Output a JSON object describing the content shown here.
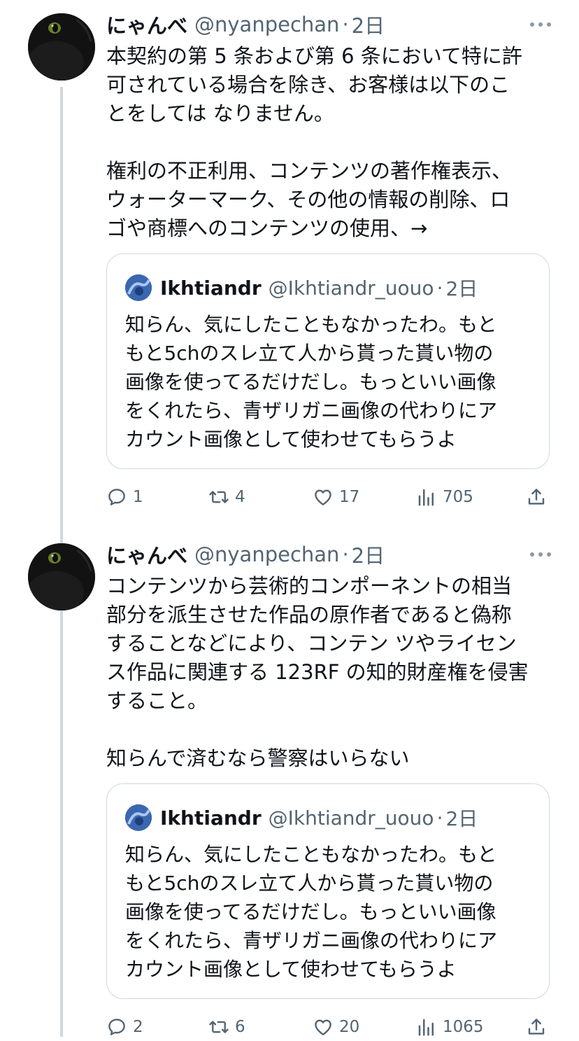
{
  "tweets": [
    {
      "author": {
        "name": "にゃんべ",
        "handle": "@nyanpechan"
      },
      "separator": "·",
      "time": "2日",
      "paragraphs": [
        [
          "本契約の第 5 条および第 6 条において特に許",
          "可されている場合を除き、お客様は以下のこ",
          "とをしては なりません。"
        ],
        [
          "権利の不正利用、コンテンツの著作権表示、",
          "ウォーターマーク、その他の情報の削除、ロ",
          "ゴや商標へのコンテンツの使用、→"
        ]
      ],
      "quote": {
        "author": {
          "name": "Ikhtiandr",
          "handle": "@Ikhtiandr_uouo"
        },
        "time": "2日",
        "lines": [
          "知らん、気にしたこともなかったわ。もと",
          "もと5chのスレ立て人から貰った貰い物の",
          "画像を使ってるだけだし。もっといい画像",
          "をくれたら、青ザリガニ画像の代わりにア",
          "カウント画像として使わせてもらうよ"
        ]
      },
      "stats": {
        "replies": "1",
        "retweets": "4",
        "likes": "17",
        "views": "705"
      }
    },
    {
      "author": {
        "name": "にゃんべ",
        "handle": "@nyanpechan"
      },
      "separator": "·",
      "time": "2日",
      "paragraphs": [
        [
          "コンテンツから芸術的コンポーネントの相当",
          "部分を派生させた作品の原作者であると偽称",
          "することなどにより、コンテン ツやライセン",
          "ス作品に関連する 123RF の知的財産権を侵害",
          "すること。"
        ],
        [
          "知らんで済むなら警察はいらない"
        ]
      ],
      "quote": {
        "author": {
          "name": "Ikhtiandr",
          "handle": "@Ikhtiandr_uouo"
        },
        "time": "2日",
        "lines": [
          "知らん、気にしたこともなかったわ。もと",
          "もと5chのスレ立て人から貰った貰い物の",
          "画像を使ってるだけだし。もっといい画像",
          "をくれたら、青ザリガニ画像の代わりにア",
          "カウント画像として使わせてもらうよ"
        ]
      },
      "stats": {
        "replies": "2",
        "retweets": "6",
        "likes": "20",
        "views": "1065"
      }
    }
  ],
  "icons": {
    "more": "more-dots-icon",
    "reply": "reply-icon",
    "retweet": "retweet-icon",
    "like": "heart-icon",
    "views": "views-icon",
    "share": "share-icon"
  },
  "colors": {
    "text": "#0f1419",
    "secondary": "#536471",
    "border": "#cfd9de",
    "background": "#ffffff"
  }
}
